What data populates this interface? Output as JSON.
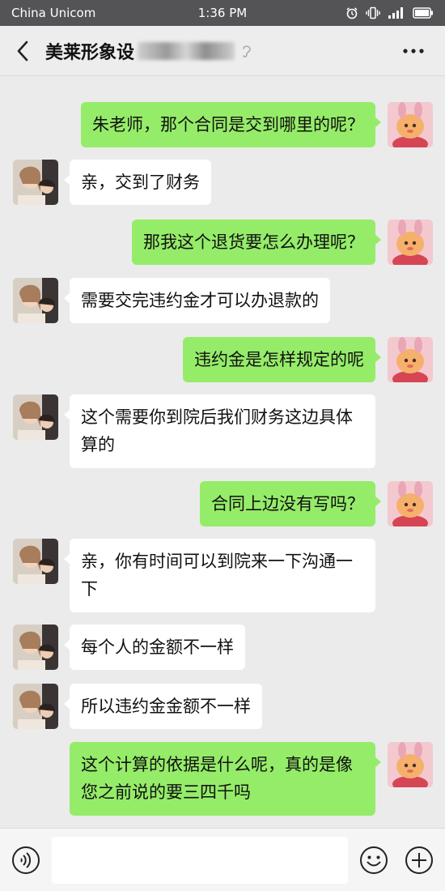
{
  "status_bar": {
    "carrier": "China Unicom",
    "time": "1:36 PM"
  },
  "header": {
    "title": "美莱形象设计",
    "title_visible": "美莱形象设"
  },
  "messages": [
    {
      "side": "out",
      "text": "朱老师，那个合同是交到哪里的呢？"
    },
    {
      "side": "in",
      "text": "亲，交到了财务"
    },
    {
      "side": "out",
      "text": "那我这个退货要怎么办理呢？"
    },
    {
      "side": "in",
      "text": "需要交完违约金才可以办退款的"
    },
    {
      "side": "out",
      "text": "违约金是怎样规定的呢"
    },
    {
      "side": "in",
      "text": "这个需要你到院后我们财务这边具体算的"
    },
    {
      "side": "out",
      "text": "合同上边没有写吗？"
    },
    {
      "side": "in",
      "text": "亲，你有时间可以到院来一下沟通一下"
    },
    {
      "side": "in",
      "text": "每个人的金额不一样"
    },
    {
      "side": "in",
      "text": "所以违约金金额不一样"
    },
    {
      "side": "out",
      "text": "这个计算的依据是什么呢，真的是像您之前说的要三四千吗"
    }
  ],
  "colors": {
    "outgoing_bubble": "#95ec69",
    "incoming_bubble": "#ffffff",
    "chat_background": "#ebebeb",
    "status_bar": "#545457"
  },
  "icons": {
    "back": "back-arrow-icon",
    "more": "more-dots-icon",
    "ear": "ear-icon",
    "voice": "voice-icon",
    "emoji": "emoji-icon",
    "plus": "plus-icon"
  },
  "input": {
    "value": ""
  }
}
